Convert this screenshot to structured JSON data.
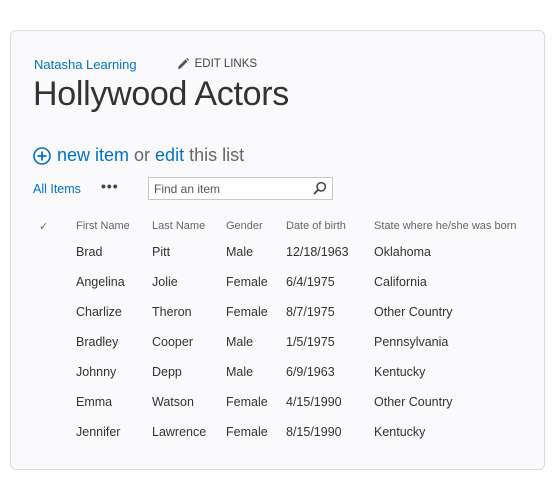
{
  "site": {
    "name": "Natasha Learning",
    "edit_links": "EDIT LINKS"
  },
  "page": {
    "title": "Hollywood Actors"
  },
  "actions": {
    "new_item": "new item",
    "or": "or",
    "edit": "edit",
    "this_list": "this list"
  },
  "views": {
    "all_items": "All Items",
    "more": "•••"
  },
  "search": {
    "placeholder": "Find an item"
  },
  "table": {
    "check_glyph": "✓",
    "columns": [
      "First Name",
      "Last Name",
      "Gender",
      "Date of birth",
      "State where he/she was born"
    ],
    "rows": [
      [
        "Brad",
        "Pitt",
        "Male",
        "12/18/1963",
        "Oklahoma"
      ],
      [
        "Angelina",
        "Jolie",
        "Female",
        "6/4/1975",
        "California"
      ],
      [
        "Charlize",
        "Theron",
        "Female",
        "8/7/1975",
        "Other Country"
      ],
      [
        "Bradley",
        "Cooper",
        "Male",
        "1/5/1975",
        "Pennsylvania"
      ],
      [
        "Johnny",
        "Depp",
        "Male",
        "6/9/1963",
        "Kentucky"
      ],
      [
        "Emma",
        "Watson",
        "Female",
        "4/15/1990",
        "Other Country"
      ],
      [
        "Jennifer",
        "Lawrence",
        "Female",
        "8/15/1990",
        "Kentucky"
      ]
    ]
  },
  "colors": {
    "link": "#0072c6",
    "text": "#333333",
    "panel_bg": "#faf9fb",
    "panel_border": "#dadae0"
  }
}
